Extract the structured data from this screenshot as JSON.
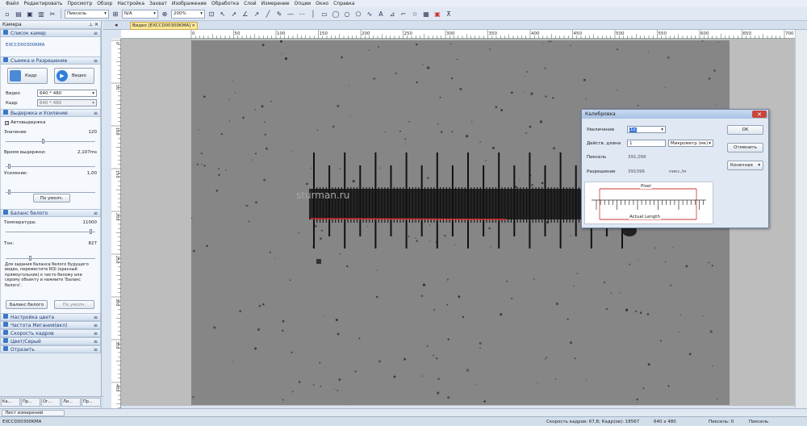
{
  "menu": [
    "Файл",
    "Редактировать",
    "Просмотр",
    "Обзор",
    "Настройка",
    "Захват",
    "Изображение",
    "Обработка",
    "Слой",
    "Измерение",
    "Опции",
    "Окно",
    "Справка"
  ],
  "toolbar": {
    "tool_select": "Пиксель",
    "na_select": "N/A",
    "zoom_select": "200%"
  },
  "left_panel": {
    "title": "Камера",
    "camera_list": {
      "title": "Список камер",
      "camera": "EXCCD00300KMA"
    },
    "capture": {
      "title": "Съемка и Разрешение",
      "photo_btn": "Кадр",
      "video_btn": "Видео",
      "video_label": "Видео",
      "video_res": "640 * 480",
      "frame_label": "Кадр",
      "frame_res": "640 * 480"
    },
    "exposure": {
      "title": "Выдержка и Усиление",
      "auto_label": "Автовыдержка",
      "value_label": "Значение",
      "value_num": "120",
      "value_level": 0.42,
      "time_label": "Время выдержки:",
      "time_num": "2,107ms",
      "time_level": 0.03,
      "gain_label": "Усиление:",
      "gain_num": "1,00",
      "gain_level": 0.03,
      "default_btn": "По умолч."
    },
    "wb": {
      "title": "Баланс белого",
      "temp_label": "Температура:",
      "temp_num": "11000",
      "temp_level": 0.97,
      "tint_label": "Тон:",
      "tint_num": "827",
      "tint_level": 0.27,
      "hint": "Для задания баланса белого будущего видео, переместите ROI (красный прямоугольник) к чисто белому или серому объекту и нажмите 'Баланс белого'.",
      "wb_btn": "Баланс белого",
      "default_btn": "По умолч."
    },
    "sections": [
      "Настройка цвета",
      "Частота Мигания(вкл)",
      "Скорость кадров",
      "Цвет/Серый",
      "Отразить"
    ]
  },
  "doc_tab": "Видео [EXCCD00300KMA]",
  "ruler_h": [
    "0",
    "50",
    "100",
    "150",
    "200",
    "250",
    "300",
    "350",
    "400",
    "450",
    "500",
    "550",
    "600",
    "650",
    "700"
  ],
  "ruler_v": [
    "0",
    "50",
    "100",
    "150",
    "200",
    "250",
    "300",
    "350",
    "400",
    "450"
  ],
  "watermark": "sturman.ru",
  "dialog": {
    "title": "Калибровка",
    "mag_label": "Увеличение",
    "mag_value": "1x",
    "len_label": "Действ. длина",
    "len_value": "1",
    "unit_value": "Микрометр (мк)",
    "pixel_label": "Пиксель",
    "pixel_value": "391,096",
    "res_label": "Разрешение",
    "res_value": "391096",
    "res_unit": "пикс./м",
    "ok_btn": "OK",
    "cancel_btn": "Отменить",
    "mode_value": "Конечная",
    "diagram_top": "Pixel",
    "diagram_bottom": "Actual Length"
  },
  "bottom_tabs": [
    "Ка...",
    "Пр...",
    "Ог...",
    "Ли...",
    "Пр..."
  ],
  "list_bar": "Лист измерений",
  "status": {
    "left": "EXCCD00300KMA",
    "fps": "Скорость кадров: 67,8; Кадр(ов): 18567",
    "size": "640 x 480",
    "pixel_count": "Пиксель: 0",
    "unit": "Пиксель"
  }
}
